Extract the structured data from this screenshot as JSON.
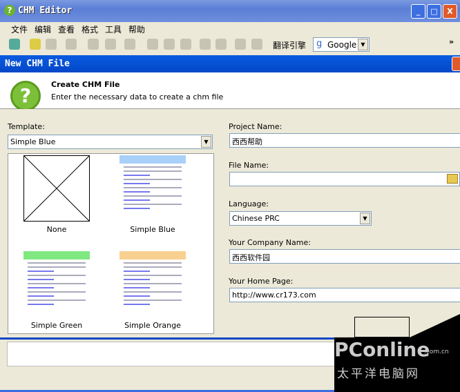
{
  "window": {
    "title": "CHM Editor",
    "minimize": "_",
    "maximize": "□",
    "close": "X"
  },
  "menu": [
    "文件",
    "编辑",
    "查看",
    "格式",
    "工具",
    "帮助"
  ],
  "toolbar": {
    "engine_label": "翻译引擎",
    "engine_value": "Google",
    "overflow": "»"
  },
  "dialog": {
    "title": "New CHM File",
    "header_title": "Create CHM File",
    "header_subtitle": "Enter the necessary data to create a chm file",
    "template_label": "Template:",
    "template_value": "Simple Blue",
    "templates": [
      {
        "name": "None"
      },
      {
        "name": "Simple Blue",
        "color": "#a8d0f8"
      },
      {
        "name": "Simple Green",
        "color": "#80e880"
      },
      {
        "name": "Simple Orange",
        "color": "#f8d090"
      }
    ],
    "project_name_label": "Project Name:",
    "project_name": "西西帮助",
    "file_name_label": "File Name:",
    "file_name": "",
    "language_label": "Language:",
    "language": "Chinese PRC",
    "company_label": "Your Company Name:",
    "company": "西西软件园",
    "homepage_label": "Your Home Page:",
    "homepage": "http://www.cr173.com"
  },
  "watermark": {
    "brand": "PConline",
    "domain": ".com.cn",
    "cn": "太平洋电脑网"
  }
}
